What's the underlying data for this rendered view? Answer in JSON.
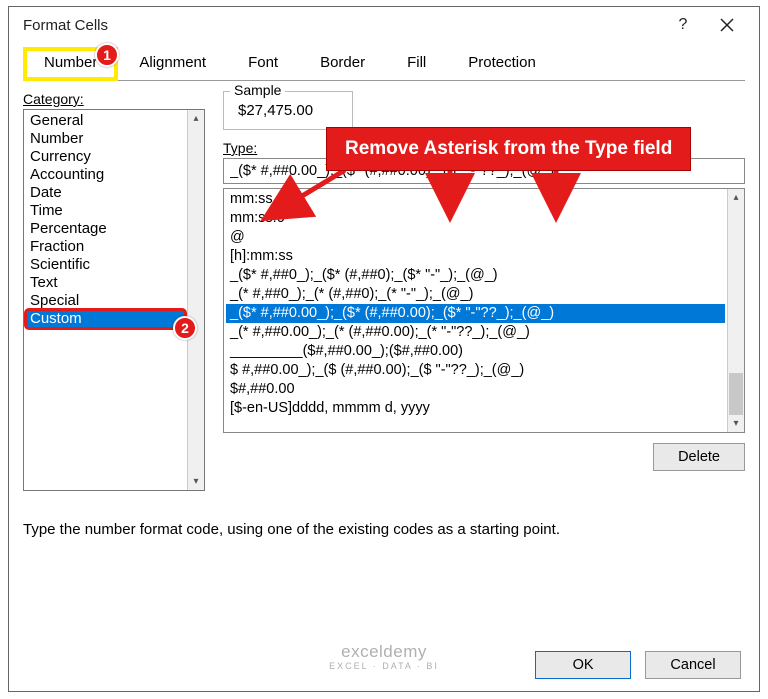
{
  "dialog": {
    "title": "Format Cells"
  },
  "titlebar": {
    "help": "?",
    "close": "close"
  },
  "tabs": [
    {
      "label": "Number",
      "active": true,
      "highlighted": true
    },
    {
      "label": "Alignment"
    },
    {
      "label": "Font"
    },
    {
      "label": "Border"
    },
    {
      "label": "Fill"
    },
    {
      "label": "Protection"
    }
  ],
  "category": {
    "label": "Category:",
    "items": [
      {
        "label": "General"
      },
      {
        "label": "Number"
      },
      {
        "label": "Currency"
      },
      {
        "label": "Accounting"
      },
      {
        "label": "Date"
      },
      {
        "label": "Time"
      },
      {
        "label": "Percentage"
      },
      {
        "label": "Fraction"
      },
      {
        "label": "Scientific"
      },
      {
        "label": "Text"
      },
      {
        "label": "Special"
      },
      {
        "label": "Custom",
        "selected": true
      }
    ]
  },
  "sample": {
    "legend": "Sample",
    "value": "$27,475.00"
  },
  "type": {
    "label": "Type:",
    "value": "_($* #,##0.00_);_($* (#,##0.00);_($* \"-\"??_);_(@_)"
  },
  "formats": {
    "items": [
      {
        "label": "mm:ss"
      },
      {
        "label": "mm:ss.0"
      },
      {
        "label": "@"
      },
      {
        "label": "[h]:mm:ss"
      },
      {
        "label": "_($* #,##0_);_($* (#,##0);_($* \"-\"_);_(@_)"
      },
      {
        "label": "_(* #,##0_);_(* (#,##0);_(* \"-\"_);_(@_)"
      },
      {
        "label": "_($* #,##0.00_);_($* (#,##0.00);_($* \"-\"??_);_(@_)",
        "selected": true
      },
      {
        "label": "_(* #,##0.00_);_(* (#,##0.00);_(* \"-\"??_);_(@_)"
      },
      {
        "label": "_________($#,##0.00_);($#,##0.00)"
      },
      {
        "label": "$ #,##0.00_);_($ (#,##0.00);_($ \"-\"??_);_(@_)"
      },
      {
        "label": "$#,##0.00"
      },
      {
        "label": "[$-en-US]dddd, mmmm d, yyyy"
      }
    ]
  },
  "buttons": {
    "delete": "Delete",
    "ok": "OK",
    "cancel": "Cancel"
  },
  "helptext": "Type the number format code, using one of the existing codes as a starting point.",
  "annot": {
    "badge1": "1",
    "badge2": "2",
    "callout": "Remove Asterisk from the Type field"
  },
  "brand": {
    "line1": "exceldemy",
    "line2": "EXCEL · DATA · BI"
  }
}
